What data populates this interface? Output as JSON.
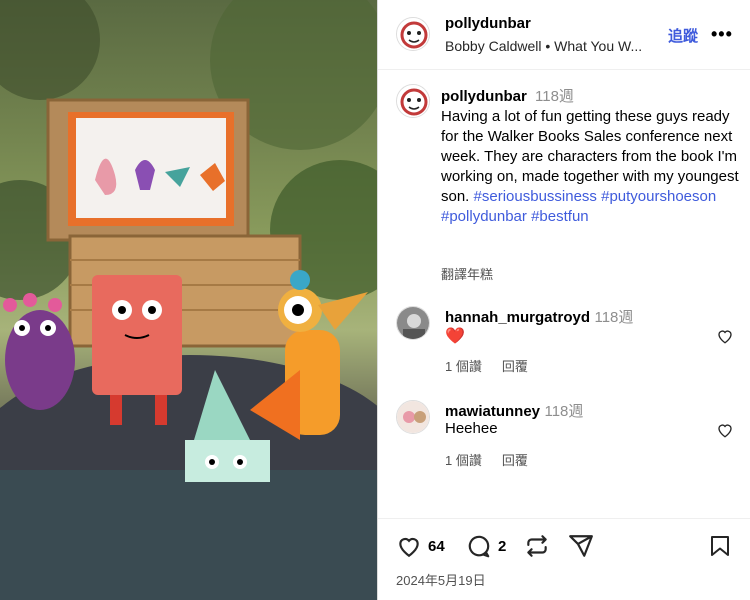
{
  "post": {
    "username": "pollydunbar",
    "audio": "Bobby Caldwell • What You W...",
    "follow_label": "追蹤",
    "more_label": "•••"
  },
  "caption": {
    "username": "pollydunbar",
    "time": "118週",
    "text": "Having a lot of fun getting these guys ready for the Walker Books Sales conference next week. They are characters from the book I'm working on, made together with my youngest son.",
    "hashtags": [
      "#seriousbussiness",
      "#putyourshoeson",
      "#pollydunbar",
      "#bestfun"
    ],
    "translate_label": "翻譯年糕"
  },
  "comments": [
    {
      "username": "hannah_murgatroyd",
      "time": "118週",
      "text": "❤️",
      "likes": "1 個讚",
      "reply": "回覆"
    },
    {
      "username": "mawiatunney",
      "time": "118週",
      "text": "Heehee",
      "likes": "1 個讚",
      "reply": "回覆"
    }
  ],
  "actions": {
    "likes_count": "64",
    "comments_count": "2",
    "date": "2024年5月19日"
  },
  "icons": [
    "heart-icon",
    "comment-icon",
    "repost-icon",
    "share-icon",
    "save-icon",
    "more-icon"
  ],
  "colors": {
    "link": "#3f5bdc",
    "muted": "#8e8e8e"
  }
}
